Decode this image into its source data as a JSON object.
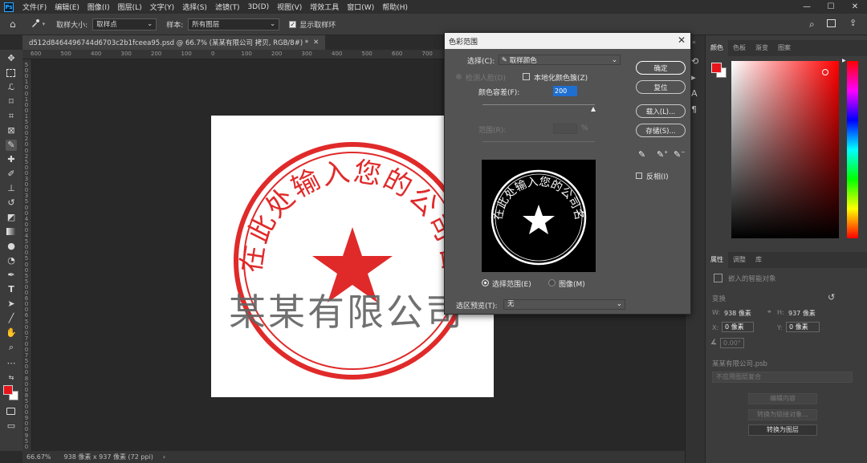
{
  "menubar": {
    "logo": "Ps",
    "items": [
      "文件(F)",
      "编辑(E)",
      "图像(I)",
      "图层(L)",
      "文字(Y)",
      "选择(S)",
      "滤镜(T)",
      "3D(D)",
      "视图(V)",
      "增效工具",
      "窗口(W)",
      "帮助(H)"
    ]
  },
  "options": {
    "sample_size_label": "取样大小:",
    "sample_size_value": "取样点",
    "sample_label": "样本:",
    "sample_value": "所有图层",
    "show_ring_label": "显示取样环",
    "show_ring_checked": true
  },
  "document": {
    "tab_title": "d512d8464496744d6703c2b1fceea95.psd @ 66.7% (某某有限公司 拷贝, RGB/8#) *",
    "overlay_text": "某某有限公司",
    "stamp_text": "请在此处输入您的公司名称",
    "stamp_color": "#e02a2a",
    "ruler_top": [
      "600",
      "500",
      "400",
      "300",
      "200",
      "100",
      "0",
      "100",
      "200",
      "300",
      "400",
      "500",
      "600",
      "700",
      "800",
      "900",
      "1000",
      "1100",
      "1200",
      "1300",
      "1400",
      "1500"
    ],
    "ruler_left": [
      "5",
      "0",
      "0",
      "1",
      "0",
      "0",
      "1",
      "0",
      "0",
      "1",
      "5",
      "0",
      "0",
      "2",
      "0",
      "0",
      "2",
      "5",
      "0",
      "0",
      "3",
      "0",
      "0",
      "3",
      "5",
      "0",
      "0",
      "4",
      "0",
      "0",
      "4",
      "5",
      "0",
      "0",
      "5",
      "0",
      "0",
      "5",
      "5",
      "0",
      "0",
      "6",
      "0",
      "0",
      "6",
      "5",
      "0",
      "0",
      "7",
      "0",
      "0",
      "7",
      "5",
      "0",
      "0",
      "8",
      "0",
      "0",
      "8",
      "5",
      "0",
      "0",
      "9",
      "0",
      "0",
      "9",
      "5",
      "0"
    ]
  },
  "status": {
    "zoom": "66.67%",
    "size": "938 像素 x 937 像素 (72 ppi)",
    "arrow": "›"
  },
  "dialog": {
    "title": "色彩范围",
    "select_label": "选择(C):",
    "select_value": "取样颜色",
    "detect_faces_label": "检测人脸(D)",
    "localized_clusters_label": "本地化颜色簇(Z)",
    "fuzziness_label": "颜色容差(F):",
    "fuzziness_value": "200",
    "range_label": "范围(R):",
    "range_unit": "%",
    "selection_radio": "选择范围(E)",
    "image_radio": "图像(M)",
    "preview_label": "选区预览(T):",
    "preview_value": "无",
    "ok": "确定",
    "reset": "复位",
    "load": "载入(L)...",
    "save": "存储(S)...",
    "invert": "反相(I)"
  },
  "color_panel": {
    "tabs": [
      "颜色",
      "色板",
      "渐变",
      "图案"
    ],
    "foreground_color": "#e8141b",
    "background_color": "#ffffff"
  },
  "properties_panel": {
    "tabs": [
      "属性",
      "调整",
      "库"
    ],
    "object_type": "嵌入的智能对象",
    "transform_label": "变换",
    "w_label": "W:",
    "w_value": "938 像素",
    "h_label": "H:",
    "h_value": "937 像素",
    "x_label": "X:",
    "x_value": "0 像素",
    "y_label": "Y:",
    "y_value": "0 像素",
    "angle_value": "0.00°",
    "file_name": "某某有限公司.psb",
    "layer_comp": "不应用图层复合",
    "edit_contents": "编辑内容",
    "convert_linked": "转换为链接对象...",
    "convert_layers": "转换为图层"
  }
}
